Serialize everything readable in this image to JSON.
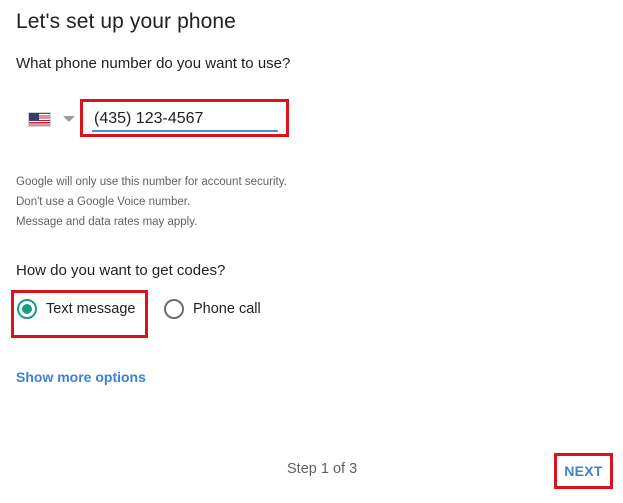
{
  "header": {
    "title": "Let's set up your phone"
  },
  "phone_section": {
    "question": "What phone number do you want to use?",
    "country_flag_icon": "us-flag-icon",
    "dropdown_icon": "caret-down-icon",
    "phone_value": "(435) 123-4567",
    "notes": [
      "Google will only use this number for account security.",
      "Don't use a Google Voice number.",
      "Message and data rates may apply."
    ]
  },
  "codes_section": {
    "question": "How do you want to get codes?",
    "options": [
      {
        "label": "Text message",
        "selected": true
      },
      {
        "label": "Phone call",
        "selected": false
      }
    ],
    "more_options_label": "Show more options"
  },
  "footer": {
    "step_text": "Step 1 of 3",
    "next_label": "NEXT"
  },
  "colors": {
    "accent_blue": "#3b82d6",
    "radio_green": "#1a9e82",
    "highlight_red": "#d9151c",
    "input_underline": "#4a90d9"
  }
}
